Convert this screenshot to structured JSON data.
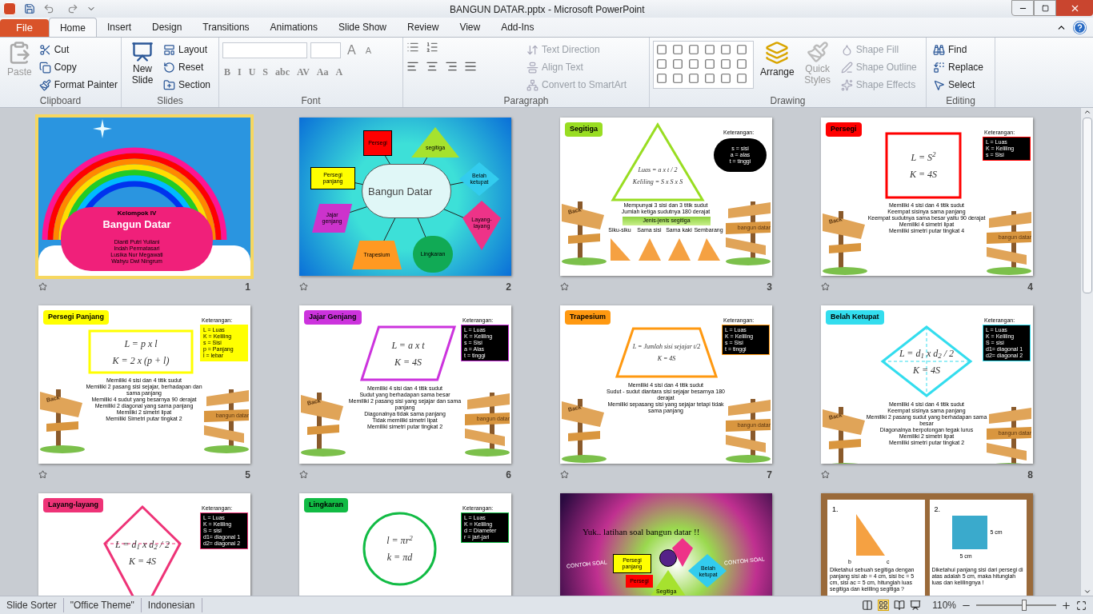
{
  "window": {
    "title": "BANGUN DATAR.pptx - Microsoft PowerPoint"
  },
  "tabs": [
    {
      "label": "File",
      "kind": "file",
      "selected": false
    },
    {
      "label": "Home",
      "kind": "tab",
      "selected": true
    },
    {
      "label": "Insert",
      "kind": "tab",
      "selected": false
    },
    {
      "label": "Design",
      "kind": "tab",
      "selected": false
    },
    {
      "label": "Transitions",
      "kind": "tab",
      "selected": false
    },
    {
      "label": "Animations",
      "kind": "tab",
      "selected": false
    },
    {
      "label": "Slide Show",
      "kind": "tab",
      "selected": false
    },
    {
      "label": "Review",
      "kind": "tab",
      "selected": false
    },
    {
      "label": "View",
      "kind": "tab",
      "selected": false
    },
    {
      "label": "Add-Ins",
      "kind": "tab",
      "selected": false
    }
  ],
  "ribbon": {
    "clipboard": {
      "label": "Clipboard",
      "paste": {
        "label": "Paste",
        "disabled": true
      },
      "items": [
        {
          "label": "Cut"
        },
        {
          "label": "Copy"
        },
        {
          "label": "Format Painter"
        }
      ]
    },
    "slides": {
      "label": "Slides",
      "new_slide": "New Slide",
      "items": [
        {
          "label": "Layout"
        },
        {
          "label": "Reset"
        },
        {
          "label": "Section"
        }
      ]
    },
    "font": {
      "label": "Font",
      "buttons": [
        "B",
        "I",
        "U",
        "S",
        "abc",
        "AV",
        "Aa",
        "A"
      ],
      "grow": "A",
      "shrink": "A"
    },
    "paragraph": {
      "label": "Paragraph",
      "items": [
        {
          "label": "Text Direction",
          "disabled": true
        },
        {
          "label": "Align Text",
          "disabled": true
        },
        {
          "label": "Convert to SmartArt",
          "disabled": true
        }
      ]
    },
    "drawing": {
      "label": "Drawing",
      "arrange": "Arrange",
      "quick_styles": {
        "label": "Quick Styles",
        "disabled": true
      },
      "items": [
        {
          "label": "Shape Fill",
          "disabled": true
        },
        {
          "label": "Shape Outline",
          "disabled": true
        },
        {
          "label": "Shape Effects",
          "disabled": true
        }
      ]
    },
    "editing": {
      "label": "Editing",
      "items": [
        {
          "label": "Find"
        },
        {
          "label": "Replace"
        },
        {
          "label": "Select"
        }
      ]
    }
  },
  "slides": [
    {
      "number": "1",
      "selected": true,
      "kind": "cover",
      "title": "Bangun Datar",
      "group": "Kelompok IV",
      "members": [
        "Dianti Putri Yuliani",
        "Indah Permatasari",
        "Lusika Nur Megawati",
        "Wahyu Dwi Ningrum"
      ]
    },
    {
      "number": "2",
      "selected": false,
      "kind": "mindmap",
      "center": "Bangun Datar",
      "nodes": [
        {
          "label": "Persegi",
          "kind": "rect",
          "color": "#ff0000"
        },
        {
          "label": "segitiga",
          "kind": "triangle",
          "color": "#a6e22e"
        },
        {
          "label": "Persegi panjang",
          "kind": "rect",
          "color": "#ffff00"
        },
        {
          "label": "Belah ketupat",
          "kind": "diamond",
          "color": "#33ccee"
        },
        {
          "label": "Jajar genjang",
          "kind": "parallelogram",
          "color": "#cc33cc"
        },
        {
          "label": "Layang-layang",
          "kind": "kite",
          "color": "#ee3388"
        },
        {
          "label": "Trapesium",
          "kind": "trapezoid",
          "color": "#ff9922"
        },
        {
          "label": "Lingkaran",
          "kind": "circle",
          "color": "#11aa55"
        }
      ]
    },
    {
      "number": "3",
      "selected": false,
      "kind": "triangle",
      "title": "Segitiga",
      "color": "#99dd22",
      "formulas": [
        "Luas = a x t / 2",
        "Keliling = S x S x S"
      ],
      "note_label": "Keterangan:",
      "note": {
        "kind": "dark",
        "lines": [
          "s = sisi",
          "a = alas",
          "t = tinggi"
        ]
      },
      "bullets": [
        "Mempunyai 3 sisi dan 3 titik sudut",
        "Jumlah ketiga sudutnya 180 derajat"
      ],
      "types_title": "Jenis-jenis segitiga",
      "types": [
        "Siku-siku",
        "Sama sisi",
        "Sama kaki",
        "Sembarang"
      ],
      "sign_labels": [
        "Back",
        "bangun datar"
      ]
    },
    {
      "number": "4",
      "selected": false,
      "kind": "square",
      "title": "Persegi",
      "color": "#ff0000",
      "formulas": [
        "L = S$^{2}$",
        "K = 4S"
      ],
      "note_label": "Keterangan:",
      "note": {
        "kind": "dark",
        "lines": [
          "L = Luas",
          "K = Keliling",
          "s = Sisi"
        ]
      },
      "bullets": [
        "Memiliki 4 sisi dan 4 titik sudut",
        "Keempat sisinya sama panjang",
        "Keempat sudutnya sama besar yaitu 90 derajat",
        "Memiliki 4 simetri lipat",
        "Memiliki simetri putar tingkat 4"
      ],
      "sign_labels": [
        "Back",
        "bangun datar"
      ]
    },
    {
      "number": "5",
      "selected": false,
      "kind": "rectangle",
      "title": "Persegi Panjang",
      "color": "#ffff00",
      "formulas": [
        "L = p x l",
        "K = 2 x (p + l)"
      ],
      "note_label": "Keterangan:",
      "note": {
        "kind": "light",
        "lines": [
          "L = Luas",
          "K = Keliling",
          "s = Sisi",
          "p = Panjang",
          "l = lebar"
        ]
      },
      "bullets": [
        "Memiliki 4 sisi dan 4 titik sudut",
        "Memiliki 2 pasang sisi sejajar, berhadapan dan sama panjang",
        "Memiliki 4 sudut yang besarnya 90 derajat",
        "Memiliki 2 diagonal yang sama panjang",
        "Memiliki 2 simetri lipat",
        "Memiliki Simetri putar tingkat 2"
      ],
      "sign_labels": [
        "Back",
        "bangun datar"
      ]
    },
    {
      "number": "6",
      "selected": false,
      "kind": "parallelogram",
      "title": "Jajar Genjang",
      "color": "#cc33dd",
      "formulas": [
        "L = a x t",
        "K = 4S"
      ],
      "note_label": "Keterangan:",
      "note": {
        "kind": "dark",
        "lines": [
          "L = Luas",
          "K = Keliling",
          "s = Sisi",
          "a = Alas",
          "t = tinggi"
        ]
      },
      "bullets": [
        "Memiliki 4 sisi dan 4 titik sudut",
        "Sudut yang berhadapan sama besar",
        "Memiliki 2 pasang sisi yang sejajar dan sama panjang",
        "Diagonalnya tidak sama panjang",
        "Tidak memiliki simetri lipat",
        "Memiliki simetri putar tingkat 2"
      ],
      "sign_labels": [
        "Back",
        "bangun datar"
      ]
    },
    {
      "number": "7",
      "selected": false,
      "kind": "trapezoid",
      "title": "Trapesium",
      "color": "#ff9911",
      "formulas": [
        "L = Jumlah sisi sejajar t/2",
        "K = 4S"
      ],
      "note_label": "Keterangan:",
      "note": {
        "kind": "dark",
        "lines": [
          "L = Luas",
          "K = Keliling",
          "s = Sisi",
          "t = tinggi"
        ]
      },
      "bullets": [
        "Memiliki 4 sisi dan 4 titik sudut",
        "Sudut - sudut diantara sisi sejajar besarnya 180 derajat",
        "Memiliki sepasang sisi yang sejajar tetapi tidak sama panjang"
      ],
      "sign_labels": [
        "Back",
        "bangun datar"
      ]
    },
    {
      "number": "8",
      "selected": false,
      "kind": "rhombus",
      "title": "Belah Ketupat",
      "color": "#33ddee",
      "formulas": [
        "L = d$_{1}$ x d$_{2}$ / 2",
        "K = 4S"
      ],
      "note_label": "Keterangan:",
      "note": {
        "kind": "dark",
        "lines": [
          "L = Luas",
          "K = Keliling",
          "S = sisi",
          "d1= diagonal 1",
          "d2= diagonal 2"
        ]
      },
      "bullets": [
        "Memiliki 4 sisi dan 4 titik sudut",
        "Keempat sisinya sama panjang",
        "Memiliki 2 pasang sudut yang berhadapan sama besar",
        "Diagonalnya berpotongan tegak lurus",
        "Memiliki 2 simetri lipat",
        "Memiliki simetri putar tingkat 2"
      ],
      "sign_labels": [
        "Back",
        "bangun datar"
      ]
    },
    {
      "selected": false,
      "kind": "kite",
      "title": "Layang-layang",
      "color": "#ee3377",
      "formulas": [
        "L = d$_{1}$ x d$_{2}$ / 2",
        "K = 4S"
      ],
      "note_label": "Keterangan:",
      "note": {
        "kind": "dark",
        "lines": [
          "L = Luas",
          "K = Keliling",
          "S = sisi",
          "d1= diagonal 1",
          "d2= diagonal 2"
        ]
      }
    },
    {
      "selected": false,
      "kind": "circle",
      "title": "Lingkaran",
      "color": "#11bb44",
      "formulas": [
        "l = πr$^{2}$",
        "k = πd"
      ],
      "note_label": "Keterangan:",
      "note": {
        "kind": "dark",
        "lines": [
          "L = Luas",
          "K = Keliling",
          "d = Diameter",
          "r = jari-jari"
        ]
      }
    },
    {
      "selected": false,
      "kind": "quiz",
      "title": "Yuk.. latihan soal bangun datar !!",
      "tags": [
        "CONTOH SOAL",
        "CONTOH SOAL"
      ],
      "shapes": [
        "Persegi panjang",
        "Persegi",
        "Segitiga",
        "Belah ketupat"
      ]
    },
    {
      "selected": false,
      "kind": "worksheet",
      "questions": [
        {
          "number": "1.",
          "kind": "triangle",
          "labels": [
            "b",
            "c"
          ],
          "text": "Diketahui sebuah segitiga dengan panjang sisi ab = 4 cm, sisi bc = 5 cm, sisi ac = 5 cm, hitunglah luas segitiga dan keliling segitiga ?"
        },
        {
          "number": "2.",
          "kind": "square",
          "labels": [
            "5 cm",
            "5 cm"
          ],
          "text": "Diketahui panjang sisi dari persegi di atas adalah 5 cm, maka hitunglah luas dan kelilingnya !"
        }
      ]
    }
  ],
  "status_bar": {
    "items": [
      "Slide Sorter",
      "\"Office Theme\"",
      "Indonesian"
    ],
    "zoom": "110%",
    "level": 0.6
  }
}
